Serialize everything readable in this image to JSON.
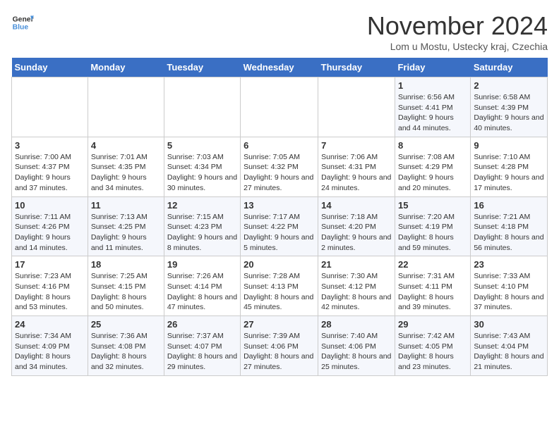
{
  "logo": {
    "line1": "General",
    "line2": "Blue"
  },
  "title": "November 2024",
  "location": "Lom u Mostu, Ustecky kraj, Czechia",
  "days_of_week": [
    "Sunday",
    "Monday",
    "Tuesday",
    "Wednesday",
    "Thursday",
    "Friday",
    "Saturday"
  ],
  "weeks": [
    [
      {
        "day": "",
        "info": ""
      },
      {
        "day": "",
        "info": ""
      },
      {
        "day": "",
        "info": ""
      },
      {
        "day": "",
        "info": ""
      },
      {
        "day": "",
        "info": ""
      },
      {
        "day": "1",
        "info": "Sunrise: 6:56 AM\nSunset: 4:41 PM\nDaylight: 9 hours and 44 minutes."
      },
      {
        "day": "2",
        "info": "Sunrise: 6:58 AM\nSunset: 4:39 PM\nDaylight: 9 hours and 40 minutes."
      }
    ],
    [
      {
        "day": "3",
        "info": "Sunrise: 7:00 AM\nSunset: 4:37 PM\nDaylight: 9 hours and 37 minutes."
      },
      {
        "day": "4",
        "info": "Sunrise: 7:01 AM\nSunset: 4:35 PM\nDaylight: 9 hours and 34 minutes."
      },
      {
        "day": "5",
        "info": "Sunrise: 7:03 AM\nSunset: 4:34 PM\nDaylight: 9 hours and 30 minutes."
      },
      {
        "day": "6",
        "info": "Sunrise: 7:05 AM\nSunset: 4:32 PM\nDaylight: 9 hours and 27 minutes."
      },
      {
        "day": "7",
        "info": "Sunrise: 7:06 AM\nSunset: 4:31 PM\nDaylight: 9 hours and 24 minutes."
      },
      {
        "day": "8",
        "info": "Sunrise: 7:08 AM\nSunset: 4:29 PM\nDaylight: 9 hours and 20 minutes."
      },
      {
        "day": "9",
        "info": "Sunrise: 7:10 AM\nSunset: 4:28 PM\nDaylight: 9 hours and 17 minutes."
      }
    ],
    [
      {
        "day": "10",
        "info": "Sunrise: 7:11 AM\nSunset: 4:26 PM\nDaylight: 9 hours and 14 minutes."
      },
      {
        "day": "11",
        "info": "Sunrise: 7:13 AM\nSunset: 4:25 PM\nDaylight: 9 hours and 11 minutes."
      },
      {
        "day": "12",
        "info": "Sunrise: 7:15 AM\nSunset: 4:23 PM\nDaylight: 9 hours and 8 minutes."
      },
      {
        "day": "13",
        "info": "Sunrise: 7:17 AM\nSunset: 4:22 PM\nDaylight: 9 hours and 5 minutes."
      },
      {
        "day": "14",
        "info": "Sunrise: 7:18 AM\nSunset: 4:20 PM\nDaylight: 9 hours and 2 minutes."
      },
      {
        "day": "15",
        "info": "Sunrise: 7:20 AM\nSunset: 4:19 PM\nDaylight: 8 hours and 59 minutes."
      },
      {
        "day": "16",
        "info": "Sunrise: 7:21 AM\nSunset: 4:18 PM\nDaylight: 8 hours and 56 minutes."
      }
    ],
    [
      {
        "day": "17",
        "info": "Sunrise: 7:23 AM\nSunset: 4:16 PM\nDaylight: 8 hours and 53 minutes."
      },
      {
        "day": "18",
        "info": "Sunrise: 7:25 AM\nSunset: 4:15 PM\nDaylight: 8 hours and 50 minutes."
      },
      {
        "day": "19",
        "info": "Sunrise: 7:26 AM\nSunset: 4:14 PM\nDaylight: 8 hours and 47 minutes."
      },
      {
        "day": "20",
        "info": "Sunrise: 7:28 AM\nSunset: 4:13 PM\nDaylight: 8 hours and 45 minutes."
      },
      {
        "day": "21",
        "info": "Sunrise: 7:30 AM\nSunset: 4:12 PM\nDaylight: 8 hours and 42 minutes."
      },
      {
        "day": "22",
        "info": "Sunrise: 7:31 AM\nSunset: 4:11 PM\nDaylight: 8 hours and 39 minutes."
      },
      {
        "day": "23",
        "info": "Sunrise: 7:33 AM\nSunset: 4:10 PM\nDaylight: 8 hours and 37 minutes."
      }
    ],
    [
      {
        "day": "24",
        "info": "Sunrise: 7:34 AM\nSunset: 4:09 PM\nDaylight: 8 hours and 34 minutes."
      },
      {
        "day": "25",
        "info": "Sunrise: 7:36 AM\nSunset: 4:08 PM\nDaylight: 8 hours and 32 minutes."
      },
      {
        "day": "26",
        "info": "Sunrise: 7:37 AM\nSunset: 4:07 PM\nDaylight: 8 hours and 29 minutes."
      },
      {
        "day": "27",
        "info": "Sunrise: 7:39 AM\nSunset: 4:06 PM\nDaylight: 8 hours and 27 minutes."
      },
      {
        "day": "28",
        "info": "Sunrise: 7:40 AM\nSunset: 4:06 PM\nDaylight: 8 hours and 25 minutes."
      },
      {
        "day": "29",
        "info": "Sunrise: 7:42 AM\nSunset: 4:05 PM\nDaylight: 8 hours and 23 minutes."
      },
      {
        "day": "30",
        "info": "Sunrise: 7:43 AM\nSunset: 4:04 PM\nDaylight: 8 hours and 21 minutes."
      }
    ]
  ]
}
